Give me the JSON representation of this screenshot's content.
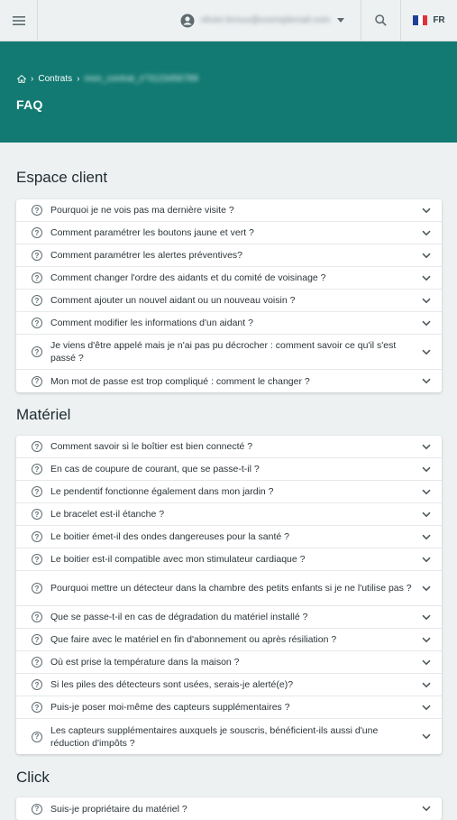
{
  "topbar": {
    "menu_icon": "hamburger-icon",
    "account_icon": "account-circle-icon",
    "email": "olivier.leroux@exemplemail.com",
    "search_icon": "search-icon",
    "language": "FR"
  },
  "hero": {
    "breadcrumb_home_icon": "home-icon",
    "breadcrumb_contracts": "Contrats",
    "breadcrumb_contract": "mon_contrat_n°0123456789",
    "title": "FAQ",
    "color": "#127a72"
  },
  "sections": [
    {
      "title": "Espace client",
      "items": [
        "Pourquoi je ne vois pas ma dernière visite ?",
        "Comment paramétrer les boutons jaune et vert ?",
        "Comment paramétrer les alertes préventives?",
        "Comment changer l'ordre des aidants et du comité de voisinage ?",
        "Comment ajouter un nouvel aidant ou un nouveau voisin ?",
        "Comment modifier les informations d'un aidant ?",
        "Je viens d'être appelé mais je n'ai pas pu décrocher : comment savoir ce qu'il s'est passé ?",
        "Mon mot de passe est trop compliqué : comment le changer ?"
      ]
    },
    {
      "title": "Matériel",
      "items": [
        "Comment savoir si le boîtier est bien connecté ?",
        "En cas de coupure de courant, que se passe-t-il ?",
        "Le pendentif fonctionne également dans mon jardin ?",
        "Le bracelet est-il étanche ?",
        "Le boitier émet-il des ondes dangereuses pour la santé ?",
        "Le boitier est-il compatible avec mon stimulateur cardiaque ?",
        "Pourquoi mettre un détecteur dans la chambre des petits enfants si je ne l'utilise pas ?",
        "Que se passe-t-il en cas de dégradation du matériel installé ?",
        "Que faire avec le matériel en fin d'abonnement ou après résiliation ?",
        "Où est prise la température dans la maison ?",
        "Si les piles des détecteurs sont usées, serais-je alerté(e)?",
        "Puis-je poser moi-même des capteurs supplémentaires ?",
        "Les capteurs supplémentaires auxquels je souscris, bénéficient-ils aussi d'une réduction d'impôts ?"
      ]
    },
    {
      "title": "Click",
      "items": [
        "Suis-je propriétaire du matériel ?"
      ]
    }
  ],
  "item_icon": "question-circle-icon",
  "expand_icon": "chevron-down-icon"
}
